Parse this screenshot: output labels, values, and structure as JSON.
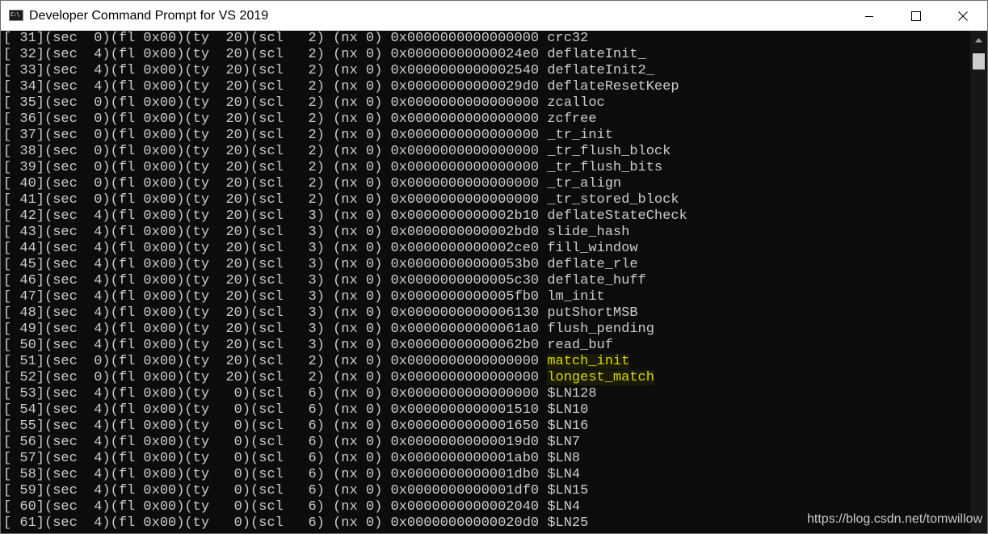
{
  "window": {
    "title": "Developer Command Prompt for VS 2019",
    "icon_glyph": "C:\\",
    "icons": {
      "app": "console-icon",
      "minimize": "minimize-icon",
      "maximize": "maximize-icon",
      "close": "close-icon"
    }
  },
  "console": {
    "text_color": "#cccccc",
    "highlight_color": "#d7d700",
    "background": "#0c0c0c",
    "lines": [
      {
        "prefix": "[ 31](sec  0)(fl 0x00)(ty  20)(scl   2) (nx 0) 0x0000000000000000 ",
        "symbol": "crc32"
      },
      {
        "prefix": "[ 32](sec  4)(fl 0x00)(ty  20)(scl   2) (nx 0) 0x00000000000024e0 ",
        "symbol": "deflateInit_"
      },
      {
        "prefix": "[ 33](sec  4)(fl 0x00)(ty  20)(scl   2) (nx 0) 0x0000000000002540 ",
        "symbol": "deflateInit2_"
      },
      {
        "prefix": "[ 34](sec  4)(fl 0x00)(ty  20)(scl   2) (nx 0) 0x00000000000029d0 ",
        "symbol": "deflateResetKeep"
      },
      {
        "prefix": "[ 35](sec  0)(fl 0x00)(ty  20)(scl   2) (nx 0) 0x0000000000000000 ",
        "symbol": "zcalloc"
      },
      {
        "prefix": "[ 36](sec  0)(fl 0x00)(ty  20)(scl   2) (nx 0) 0x0000000000000000 ",
        "symbol": "zcfree"
      },
      {
        "prefix": "[ 37](sec  0)(fl 0x00)(ty  20)(scl   2) (nx 0) 0x0000000000000000 ",
        "symbol": "_tr_init"
      },
      {
        "prefix": "[ 38](sec  0)(fl 0x00)(ty  20)(scl   2) (nx 0) 0x0000000000000000 ",
        "symbol": "_tr_flush_block"
      },
      {
        "prefix": "[ 39](sec  0)(fl 0x00)(ty  20)(scl   2) (nx 0) 0x0000000000000000 ",
        "symbol": "_tr_flush_bits"
      },
      {
        "prefix": "[ 40](sec  0)(fl 0x00)(ty  20)(scl   2) (nx 0) 0x0000000000000000 ",
        "symbol": "_tr_align"
      },
      {
        "prefix": "[ 41](sec  0)(fl 0x00)(ty  20)(scl   2) (nx 0) 0x0000000000000000 ",
        "symbol": "_tr_stored_block"
      },
      {
        "prefix": "[ 42](sec  4)(fl 0x00)(ty  20)(scl   3) (nx 0) 0x0000000000002b10 ",
        "symbol": "deflateStateCheck"
      },
      {
        "prefix": "[ 43](sec  4)(fl 0x00)(ty  20)(scl   3) (nx 0) 0x0000000000002bd0 ",
        "symbol": "slide_hash"
      },
      {
        "prefix": "[ 44](sec  4)(fl 0x00)(ty  20)(scl   3) (nx 0) 0x0000000000002ce0 ",
        "symbol": "fill_window"
      },
      {
        "prefix": "[ 45](sec  4)(fl 0x00)(ty  20)(scl   3) (nx 0) 0x00000000000053b0 ",
        "symbol": "deflate_rle"
      },
      {
        "prefix": "[ 46](sec  4)(fl 0x00)(ty  20)(scl   3) (nx 0) 0x0000000000005c30 ",
        "symbol": "deflate_huff"
      },
      {
        "prefix": "[ 47](sec  4)(fl 0x00)(ty  20)(scl   3) (nx 0) 0x0000000000005fb0 ",
        "symbol": "lm_init"
      },
      {
        "prefix": "[ 48](sec  4)(fl 0x00)(ty  20)(scl   3) (nx 0) 0x0000000000006130 ",
        "symbol": "putShortMSB"
      },
      {
        "prefix": "[ 49](sec  4)(fl 0x00)(ty  20)(scl   3) (nx 0) 0x00000000000061a0 ",
        "symbol": "flush_pending"
      },
      {
        "prefix": "[ 50](sec  4)(fl 0x00)(ty  20)(scl   3) (nx 0) 0x00000000000062b0 ",
        "symbol": "read_buf"
      },
      {
        "prefix": "[ 51](sec  0)(fl 0x00)(ty  20)(scl   2) (nx 0) 0x0000000000000000 ",
        "symbol": "match_init",
        "highlight": true
      },
      {
        "prefix": "[ 52](sec  0)(fl 0x00)(ty  20)(scl   2) (nx 0) 0x0000000000000000 ",
        "symbol": "longest_match",
        "highlight": true
      },
      {
        "prefix": "[ 53](sec  4)(fl 0x00)(ty   0)(scl   6) (nx 0) 0x0000000000000000 ",
        "symbol": "$LN128"
      },
      {
        "prefix": "[ 54](sec  4)(fl 0x00)(ty   0)(scl   6) (nx 0) 0x0000000000001510 ",
        "symbol": "$LN10"
      },
      {
        "prefix": "[ 55](sec  4)(fl 0x00)(ty   0)(scl   6) (nx 0) 0x0000000000001650 ",
        "symbol": "$LN16"
      },
      {
        "prefix": "[ 56](sec  4)(fl 0x00)(ty   0)(scl   6) (nx 0) 0x00000000000019d0 ",
        "symbol": "$LN7"
      },
      {
        "prefix": "[ 57](sec  4)(fl 0x00)(ty   0)(scl   6) (nx 0) 0x0000000000001ab0 ",
        "symbol": "$LN8"
      },
      {
        "prefix": "[ 58](sec  4)(fl 0x00)(ty   0)(scl   6) (nx 0) 0x0000000000001db0 ",
        "symbol": "$LN4"
      },
      {
        "prefix": "[ 59](sec  4)(fl 0x00)(ty   0)(scl   6) (nx 0) 0x0000000000001df0 ",
        "symbol": "$LN15"
      },
      {
        "prefix": "[ 60](sec  4)(fl 0x00)(ty   0)(scl   6) (nx 0) 0x0000000000002040 ",
        "symbol": "$LN4"
      },
      {
        "prefix": "[ 61](sec  4)(fl 0x00)(ty   0)(scl   6) (nx 0) 0x00000000000020d0 ",
        "symbol": "$LN25"
      }
    ]
  },
  "scrollbar": {
    "icons": {
      "up": "scroll-up-arrow-icon"
    }
  },
  "watermark": "https://blog.csdn.net/tomwillow"
}
